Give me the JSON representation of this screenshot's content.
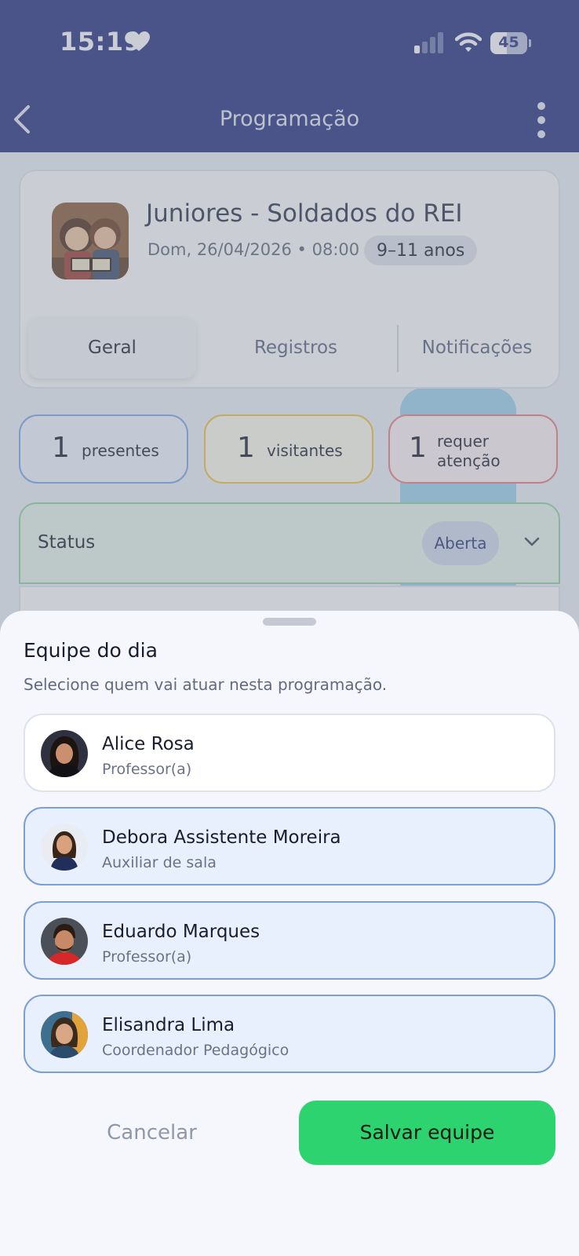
{
  "status_bar": {
    "time": "15:19",
    "battery_level": "45",
    "battery_fraction": 0.45
  },
  "app_bar": {
    "title": "Programação"
  },
  "class_card": {
    "title": "Juniores - Soldados do REI",
    "date": "Dom, 26/04/2026 • 08:00",
    "age_range": "9–11 anos",
    "tabs": [
      {
        "label": "Geral",
        "active": true
      },
      {
        "label": "Registros",
        "active": false
      },
      {
        "label": "Notificações",
        "active": false
      }
    ]
  },
  "stats": [
    {
      "value": "1",
      "label": "presentes",
      "color": "#7aa6ea"
    },
    {
      "value": "1",
      "label": "visitantes",
      "color": "#f2c340"
    },
    {
      "value": "1",
      "label_line1": "requer",
      "label_line2": "atenção",
      "color": "#f07a80"
    }
  ],
  "status": {
    "label": "Status",
    "value": "Aberta"
  },
  "sheet": {
    "title": "Equipe do dia",
    "subtitle": "Selecione quem vai atuar nesta programação.",
    "members": [
      {
        "name": "Alice Rosa",
        "role": "Professor(a)",
        "selected": false
      },
      {
        "name": "Debora Assistente Moreira",
        "role": "Auxiliar de sala",
        "selected": true
      },
      {
        "name": "Eduardo Marques",
        "role": "Professor(a)",
        "selected": true
      },
      {
        "name": "Elisandra Lima",
        "role": "Coordenador Pedagógico",
        "selected": true
      }
    ],
    "cancel_label": "Cancelar",
    "save_label": "Salvar equipe"
  },
  "colors": {
    "header": "#232e7c",
    "primary_action": "#2dd36f",
    "selected_border": "#7a9fd0"
  }
}
